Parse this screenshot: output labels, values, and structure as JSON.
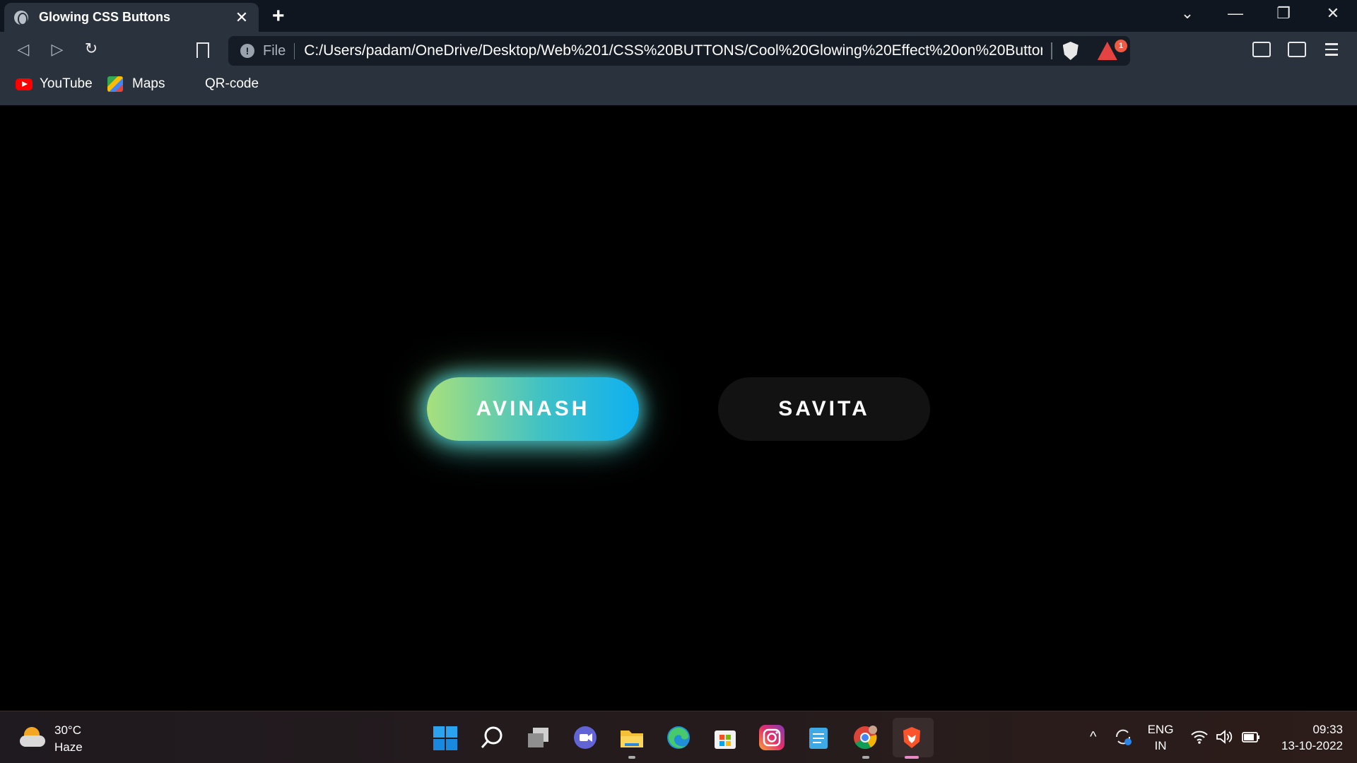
{
  "browser": {
    "tab_title": "Glowing CSS Buttons",
    "tab_close": "✕",
    "new_tab": "+",
    "url_scheme": "File",
    "url": "C:/Users/padam/OneDrive/Desktop/Web%201/CSS%20BUTTONS/Cool%20Glowing%20Effect%20on%20Button...",
    "rewards_count": "1",
    "window_controls": {
      "tabs_dropdown": "⌄",
      "minimize": "—",
      "restore": "❐",
      "close": "✕"
    },
    "nav": {
      "back": "◁",
      "forward": "▷",
      "reload": "↻"
    }
  },
  "bookmarks": [
    {
      "label": "YouTube",
      "icon": "youtube-icon"
    },
    {
      "label": "Maps",
      "icon": "maps-icon"
    },
    {
      "label": "QR-code"
    }
  ],
  "page": {
    "buttons": [
      {
        "label": "AVINASH",
        "state": "hover-glow",
        "gradient": [
          "#a8e07c",
          "#0fb0f0"
        ]
      },
      {
        "label": "SAVITA",
        "state": "default",
        "color": "#121212"
      }
    ]
  },
  "taskbar": {
    "weather_temp": "30°C",
    "weather_desc": "Haze",
    "language_line1": "ENG",
    "language_line2": "IN",
    "time": "09:33",
    "date": "13-10-2022",
    "pinned": [
      "start-icon",
      "search-icon",
      "task-view-icon",
      "teams-chat-icon",
      "file-explorer-icon",
      "edge-icon",
      "microsoft-store-icon",
      "instagram-icon",
      "notepad-icon",
      "chrome-icon",
      "brave-icon"
    ]
  }
}
